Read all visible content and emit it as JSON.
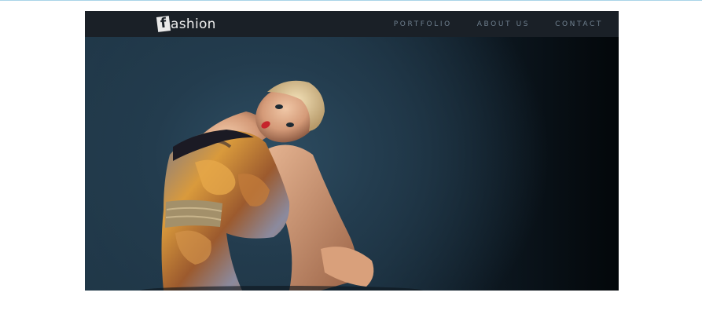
{
  "brand": {
    "logo_mark": "f",
    "logo_text": "ashion"
  },
  "nav": {
    "items": [
      {
        "label": "PORTFOLIO"
      },
      {
        "label": "ABOUT US"
      },
      {
        "label": "CONTACT"
      }
    ]
  },
  "colors": {
    "navbar_bg": "#1a2027",
    "nav_text": "#6e7f8e",
    "hero_dark": "#03070a",
    "hero_teal": "#2e4e63"
  },
  "icons": {
    "logo": "f-badge-icon"
  }
}
